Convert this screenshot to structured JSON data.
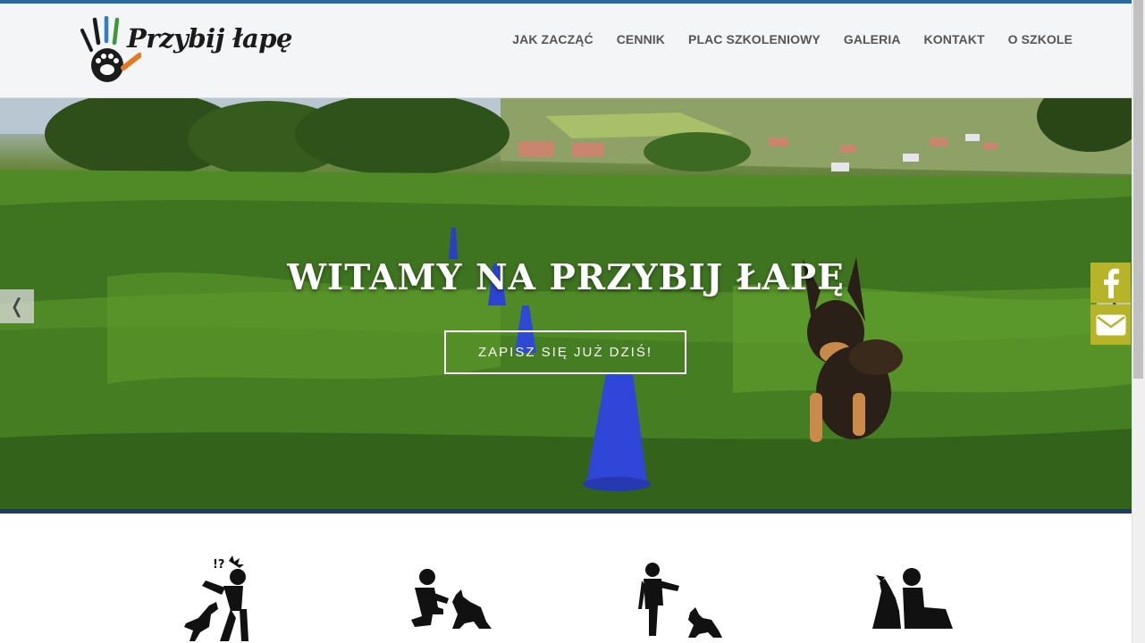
{
  "header": {
    "logo_text": "Przybij łapę",
    "nav": [
      {
        "label": "JAK ZACZĄĆ"
      },
      {
        "label": "CENNIK"
      },
      {
        "label": "PLAC SZKOLENIOWY"
      },
      {
        "label": "GALERIA"
      },
      {
        "label": "KONTAKT"
      },
      {
        "label": "O SZKOLE"
      }
    ]
  },
  "hero": {
    "title": "WITAMY NA PRZYBIJ ŁAPĘ",
    "cta_label": "ZAPISZ SIĘ JUŻ DZIŚ!",
    "prev_arrow": "❬",
    "next_arrow": "❭"
  },
  "social": {
    "facebook_icon": "facebook-icon",
    "mail_icon": "envelope-icon",
    "accent": "#b7b42a"
  },
  "features": [
    {
      "icon": "confused-person-with-dog-icon"
    },
    {
      "icon": "crouching-person-with-dog-icon"
    },
    {
      "icon": "standing-person-with-dog-icon"
    },
    {
      "icon": "sitting-person-with-dog-icon"
    }
  ],
  "colors": {
    "header_bg": "#f4f5f6",
    "nav_text": "#555555",
    "top_accent": "#2a6aa0"
  }
}
